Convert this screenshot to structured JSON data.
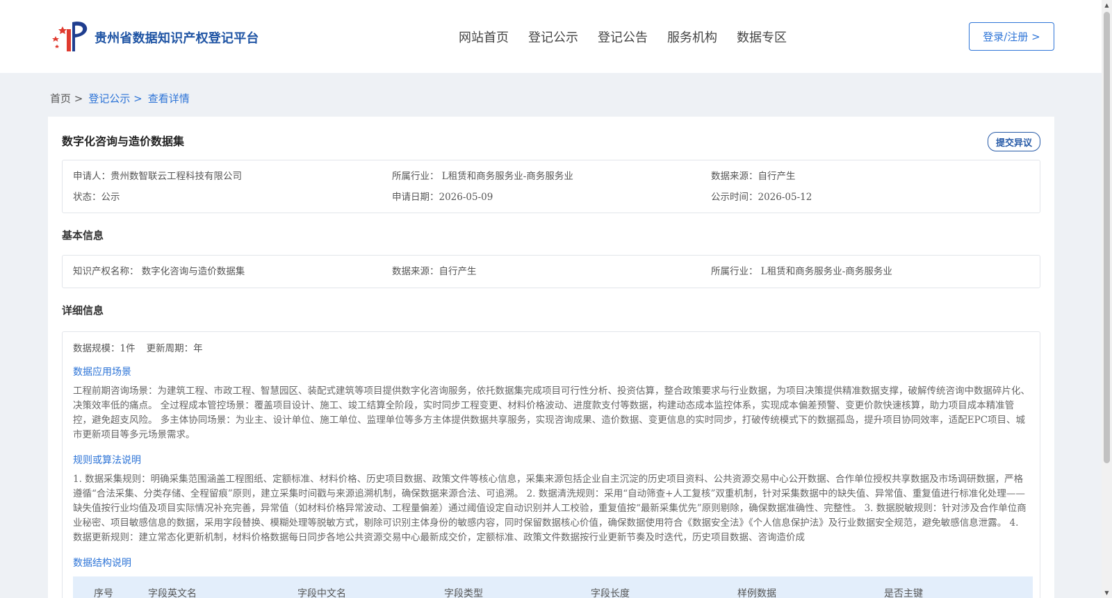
{
  "header": {
    "logo_title": "贵州省数据知识产权登记平台",
    "nav": [
      "网站首页",
      "登记公示",
      "登记公告",
      "服务机构",
      "数据专区"
    ],
    "login_label": "登录/注册 >"
  },
  "breadcrumb": {
    "home": "首页 >",
    "publicity": "登记公示 >",
    "detail": "查看详情"
  },
  "page": {
    "title": "数字化咨询与造价数据集",
    "objection_label": "提交异议"
  },
  "summary": {
    "applicant": "申请人：贵州数智联云工程科技有限公司",
    "industry": "所属行业： L租赁和商务服务业-商务服务业",
    "source": "数据来源：自行产生",
    "status": "状态：公示",
    "apply_date": "申请日期：2026-05-09",
    "publicity_time": "公示时间：2026-05-12"
  },
  "basic": {
    "section_title": "基本信息",
    "ip_name": "知识产权名称： 数字化咨询与造价数据集",
    "source": "数据来源：自行产生",
    "industry": "所属行业： L租赁和商务服务业-商务服务业"
  },
  "detail": {
    "section_title": "详细信息",
    "scale": "数据规模：1件",
    "cycle": "更新周期：年",
    "scenario_title": "数据应用场景",
    "scenario_text": "工程前期咨询场景：为建筑工程、市政工程、智慧园区、装配式建筑等项目提供数字化咨询服务，依托数据集完成项目可行性分析、投资估算，整合政策要求与行业数据，为项目决策提供精准数据支撑，破解传统咨询中数据碎片化、决策效率低的痛点。 全过程成本管控场景：覆盖项目设计、施工、竣工结算全阶段，实时同步工程变更、材料价格波动、进度款支付等数据，构建动态成本监控体系，实现成本偏差预警、变更价款快速核算，助力项目成本精准管控，避免超支风险。 多主体协同场景：为业主、设计单位、施工单位、监理单位等多方主体提供数据共享服务，实现咨询成果、造价数据、变更信息的实时同步，打破传统模式下的数据孤岛，提升项目协同效率，适配EPC项目、城市更新项目等多元场景需求。",
    "rules_title": "规则或算法说明",
    "rules_text": "1. 数据采集规则：明确采集范围涵盖工程图纸、定额标准、材料价格、历史项目数据、政策文件等核心信息，采集来源包括企业自主沉淀的历史项目资料、公共资源交易中心公开数据、合作单位授权共享数据及市场调研数据，严格遵循“合法采集、分类存储、全程留痕”原则，建立采集时间戳与来源追溯机制，确保数据来源合法、可追溯。 2. 数据清洗规则：采用“自动筛查+人工复核”双重机制，针对采集数据中的缺失值、异常值、重复值进行标准化处理——缺失值按行业均值及项目实际情况补充完善，异常值（如材料价格异常波动、工程量偏差）通过阈值设定自动识别并人工校验，重复值按“最新采集优先”原则剔除，确保数据准确性、完整性。 3. 数据脱敏规则：针对涉及合作单位商业秘密、项目敏感信息的数据，采用字段替换、模糊处理等脱敏方式，剔除可识别主体身份的敏感内容，同时保留数据核心价值，确保数据使用符合《数据安全法》《个人信息保护法》及行业数据安全规范，避免敏感信息泄露。 4. 数据更新规则：建立常态化更新机制，材料价格数据每日同步各地公共资源交易中心最新成交价，定额标准、政策文件数据按行业更新节奏及时迭代，历史项目数据、咨询造价成",
    "structure_title": "数据结构说明",
    "table_headers": [
      "序号",
      "字段英文名",
      "字段中文名",
      "字段类型",
      "字段长度",
      "样例数据",
      "是否主键"
    ]
  }
}
